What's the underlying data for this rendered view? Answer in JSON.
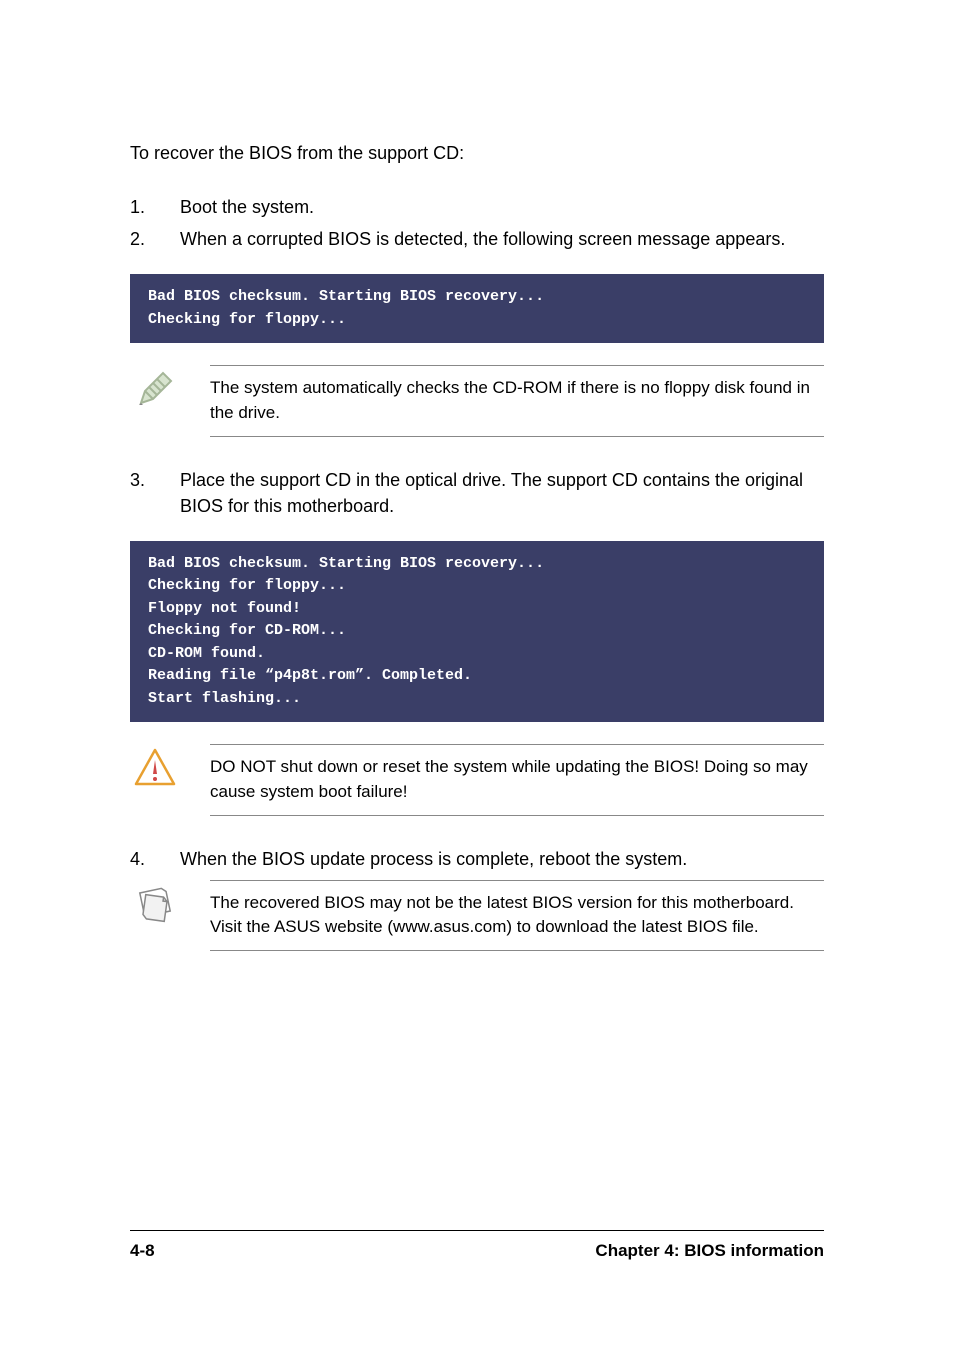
{
  "intro": "To recover the BIOS from the support CD:",
  "steps": {
    "s1": {
      "num": "1.",
      "text": "Boot the system."
    },
    "s2": {
      "num": "2.",
      "text": "When a corrupted BIOS is detected, the following screen message appears."
    },
    "s3": {
      "num": "3.",
      "text": "Place the support CD in the optical drive. The support CD contains the original BIOS for this motherboard."
    },
    "s4": {
      "num": "4.",
      "text": "When the BIOS update process is complete, reboot the system."
    }
  },
  "code1": "Bad BIOS checksum. Starting BIOS recovery...\nChecking for floppy...",
  "code2": "Bad BIOS checksum. Starting BIOS recovery...\nChecking for floppy...\nFloppy not found!\nChecking for CD-ROM...\nCD-ROM found.\nReading file “p4p8t.rom”. Completed.\nStart flashing...",
  "note1": "The system automatically checks the CD-ROM if there is no floppy disk found in the drive.",
  "note2": "DO NOT shut down or reset the system while updating the BIOS! Doing so may cause system boot failure!",
  "note3": "The recovered BIOS may not be the latest BIOS version for this motherboard. Visit the ASUS website (www.asus.com) to download the latest BIOS file.",
  "footer": {
    "left": "4-8",
    "right": "Chapter 4: BIOS information"
  }
}
